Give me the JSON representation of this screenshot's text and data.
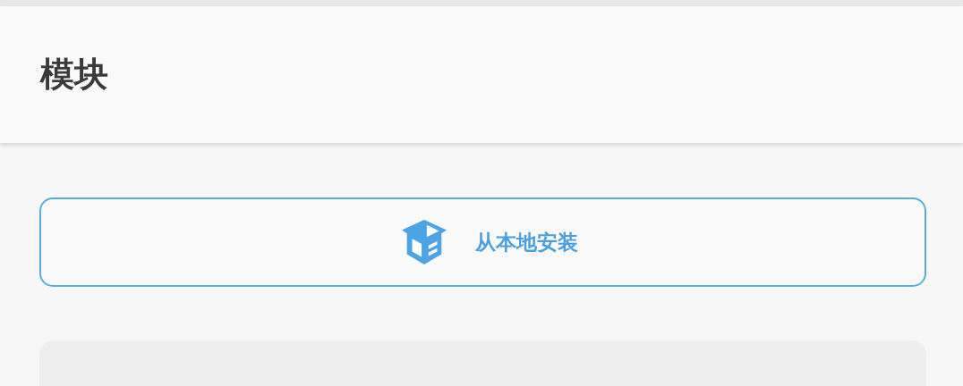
{
  "header": {
    "title": "模块"
  },
  "install_button": {
    "label": "从本地安装"
  }
}
